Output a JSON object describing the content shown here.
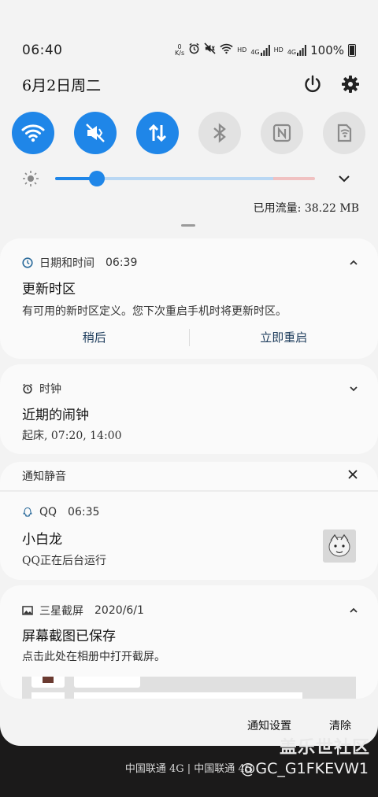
{
  "status_bar": {
    "time": "06:40",
    "net_speed_value": "0",
    "net_speed_unit": "K/s",
    "signal_labels": [
      "HD",
      "4G",
      "HD",
      "4G"
    ],
    "battery": "100%",
    "icons": [
      "alarm-icon",
      "mute-icon",
      "wifi-icon",
      "signal-icon",
      "battery-icon"
    ]
  },
  "header": {
    "date": "6月2日周二",
    "icons": [
      "power-icon",
      "settings-icon"
    ]
  },
  "quick_toggles": [
    {
      "icon": "wifi-icon",
      "state": "on"
    },
    {
      "icon": "mute-icon",
      "state": "on"
    },
    {
      "icon": "mobile-data-icon",
      "state": "on"
    },
    {
      "icon": "bluetooth-icon",
      "state": "off"
    },
    {
      "icon": "nfc-icon",
      "state": "off"
    },
    {
      "icon": "share-icon",
      "state": "off"
    }
  ],
  "brightness": {
    "level": 0.16,
    "accent": "#1f86e8"
  },
  "data_usage": "已用流量: 38.22 MB",
  "notifications": {
    "datetime_card": {
      "app": "日期和时间",
      "time": "06:39",
      "title": "更新时区",
      "body": "有可用的新时区定义。您下次重启手机时将更新时区。",
      "action_later": "稍后",
      "action_restart": "立即重启"
    },
    "clock_card": {
      "app": "时钟",
      "title": "近期的闹钟",
      "body": "起床, 07:20, 14:00"
    },
    "silent_section": {
      "label": "通知静音"
    },
    "qq_card": {
      "app": "QQ",
      "time": "06:35",
      "title": "小白龙",
      "body": "QQ正在后台运行"
    },
    "screenshot_card": {
      "app": "三星截屏",
      "time": "2020/6/1",
      "title": "屏幕截图已保存",
      "body": "点击此处在相册中打开截屏。"
    }
  },
  "footer": {
    "settings_label": "通知设置",
    "clear_label": "清除"
  },
  "carrier_text": "中国联通 4G | 中国联通 4G",
  "watermark": {
    "line1": "盖乐世社区",
    "line2": "@GC_G1FKEVW1"
  }
}
